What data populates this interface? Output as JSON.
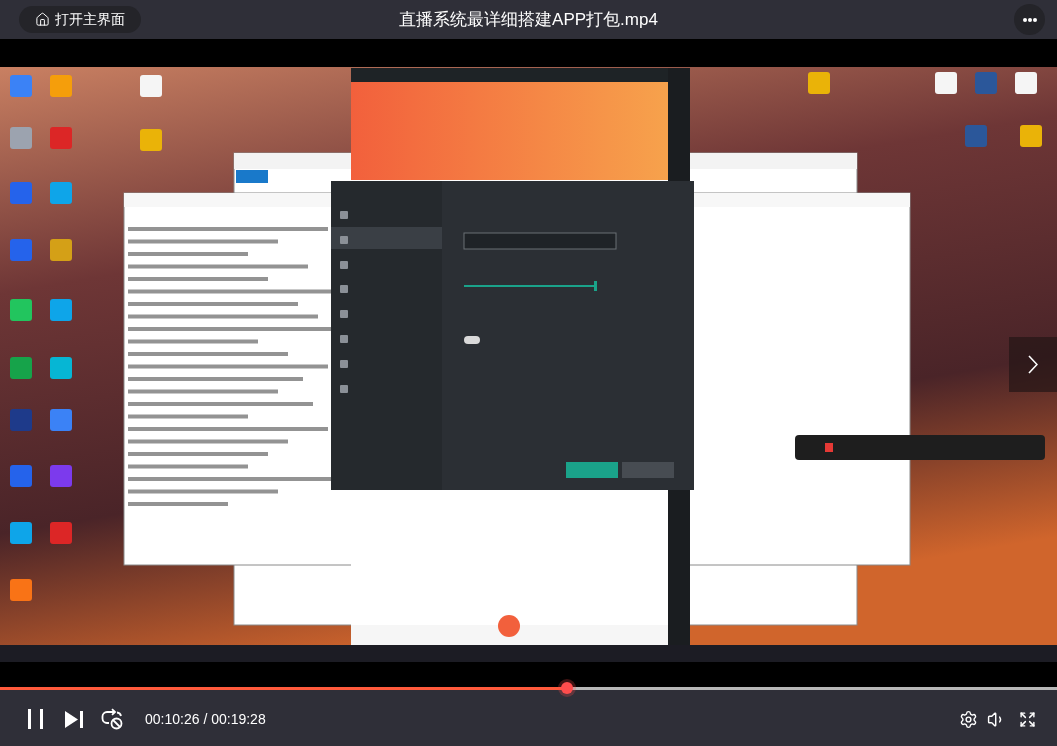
{
  "top_bar": {
    "home_button": {
      "label": "打开主界面"
    },
    "title": "直播系统最详细搭建APP打包.mp4"
  },
  "player": {
    "playing": true,
    "loop": false,
    "progress": {
      "level": 0.536
    },
    "time": "00:10:26 / 00:19:28"
  }
}
